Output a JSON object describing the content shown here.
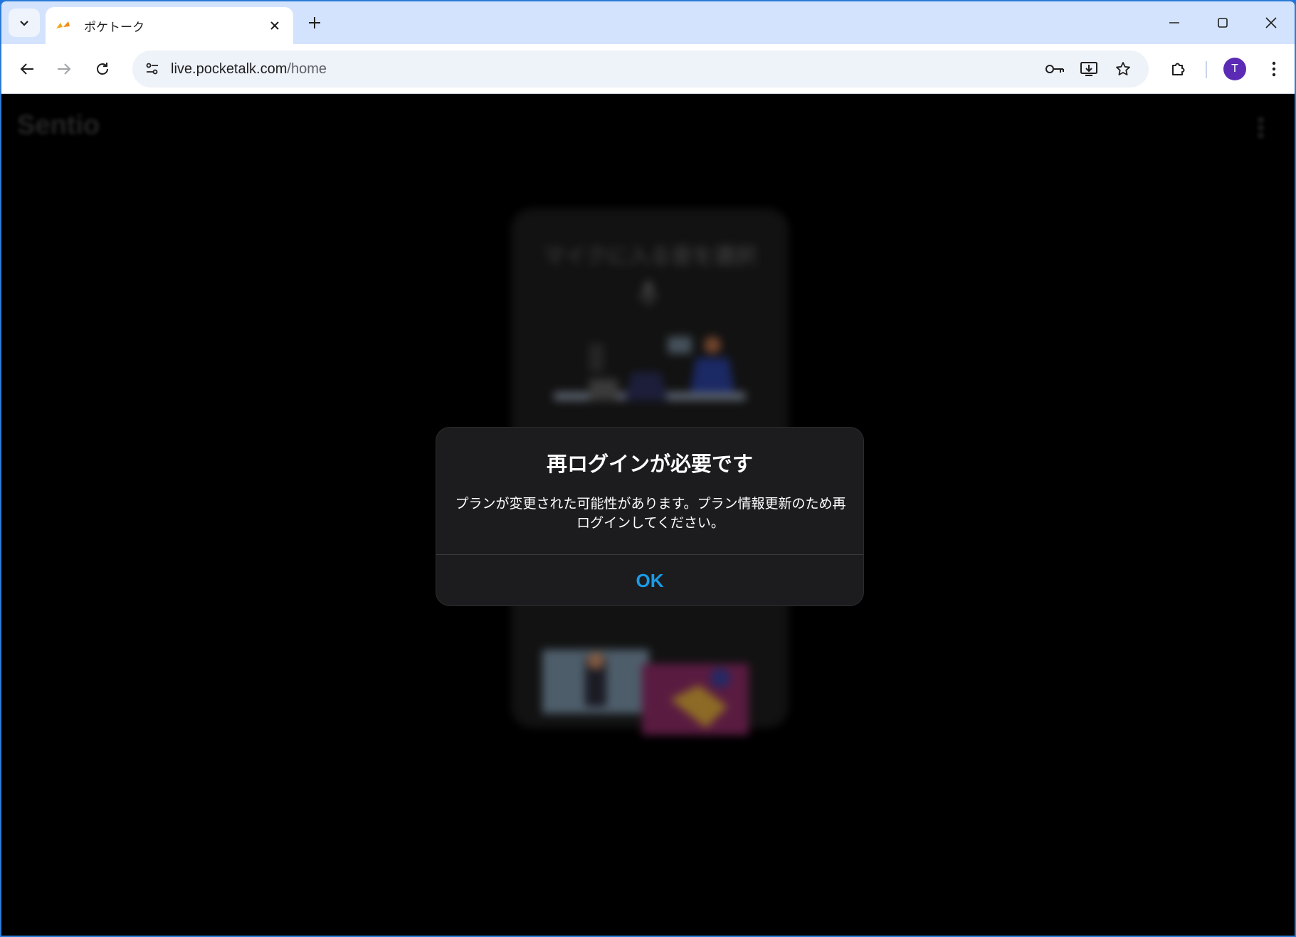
{
  "browser": {
    "tab": {
      "title": "ポケトーク",
      "favicon": "pocketalk-logo-icon"
    },
    "url_host": "live.pocketalk.com",
    "url_path": "/home",
    "profile_initial": "T",
    "colors": {
      "tabstrip": "#d3e3fd",
      "avatar": "#5b2bb5"
    }
  },
  "app": {
    "logo_text": "Sentio",
    "card_title": "マイクに入る音を選択"
  },
  "dialog": {
    "title": "再ログインが必要です",
    "message_line1": "プランが変更された可能性があります。プラン情報更新のため再",
    "message_line2": "ログインしてください。",
    "ok_label": "OK",
    "colors": {
      "background": "#1c1c1e",
      "ok": "#1a9be6"
    }
  }
}
